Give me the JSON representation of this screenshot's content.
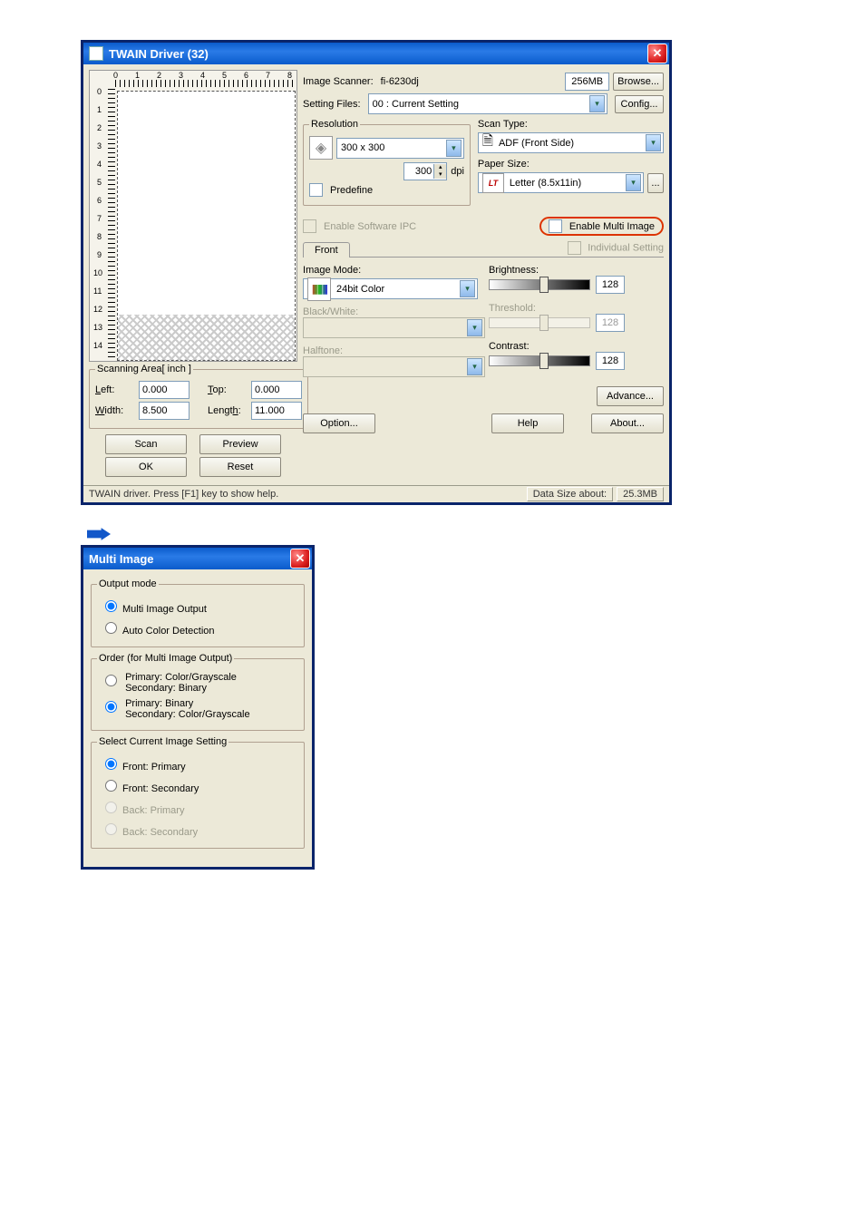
{
  "twain": {
    "title": "TWAIN Driver (32)",
    "ruler_top": [
      "0",
      "1",
      "2",
      "3",
      "4",
      "5",
      "6",
      "7",
      "8"
    ],
    "ruler_left": [
      "0",
      "1",
      "2",
      "3",
      "4",
      "5",
      "6",
      "7",
      "8",
      "9",
      "10",
      "11",
      "12",
      "13",
      "14"
    ],
    "scanning_area": {
      "legend": "Scanning Area[ inch ]",
      "left_label": "Left:",
      "left_value": "0.000",
      "top_label": "Top:",
      "top_value": "0.000",
      "width_label": "Width:",
      "width_value": "8.500",
      "length_label": "Length:",
      "length_value": "11.000"
    },
    "buttons": {
      "scan": "Scan",
      "preview": "Preview",
      "ok": "OK",
      "reset": "Reset",
      "option": "Option...",
      "help": "Help",
      "about": "About...",
      "advance": "Advance...",
      "browse": "Browse...",
      "config": "Config...",
      "more": "..."
    },
    "right": {
      "image_scanner_label": "Image Scanner:",
      "image_scanner_value": "fi-6230dj",
      "mem": "256MB",
      "setting_files_label": "Setting Files:",
      "setting_files_value": "00 : Current Setting",
      "resolution_label": "Resolution",
      "resolution_value": "300 x 300",
      "dpi_value": "300",
      "dpi_unit": "dpi",
      "predefine": "Predefine",
      "scan_type_label": "Scan Type:",
      "scan_type_value": "ADF (Front Side)",
      "paper_size_label": "Paper Size:",
      "paper_size_value": "Letter (8.5x11in)",
      "lt": "LT",
      "enable_ipc": "Enable Software IPC",
      "enable_multi": "Enable Multi Image",
      "front_tab": "Front",
      "individual": "Individual Setting",
      "image_mode_label": "Image Mode:",
      "image_mode_value": "24bit Color",
      "brightness_label": "Brightness:",
      "brightness_value": "128",
      "contrast_label": "Contrast:",
      "contrast_value": "128",
      "threshold_label": "Threshold:",
      "threshold_value": "128",
      "bw_label": "Black/White:",
      "halftone_label": "Halftone:"
    },
    "status": {
      "help": "TWAIN driver. Press [F1] key to show help.",
      "data_about": "Data Size about:",
      "data_size": "25.3MB"
    }
  },
  "multi": {
    "title": "Multi Image",
    "output_mode": {
      "legend": "Output mode",
      "opt1": "Multi Image Output",
      "opt2": "Auto Color Detection"
    },
    "order": {
      "legend": "Order (for Multi Image Output)",
      "opt1a": "Primary: Color/Grayscale",
      "opt1b": "Secondary: Binary",
      "opt2a": "Primary: Binary",
      "opt2b": "Secondary: Color/Grayscale"
    },
    "select": {
      "legend": "Select Current Image Setting",
      "opt1": "Front: Primary",
      "opt2": "Front: Secondary",
      "opt3": "Back: Primary",
      "opt4": "Back: Secondary"
    }
  }
}
